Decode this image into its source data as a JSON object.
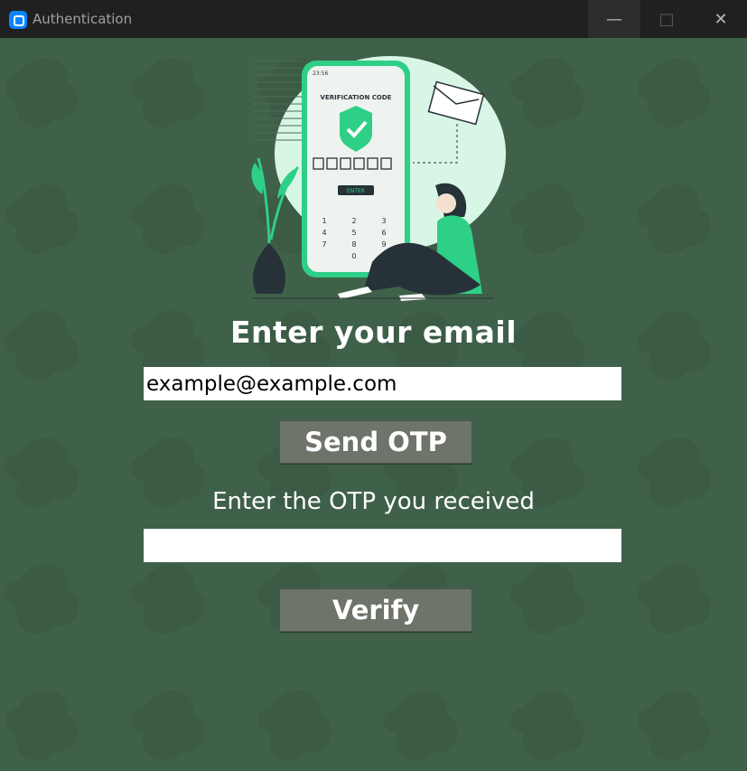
{
  "window": {
    "title": "Authentication",
    "minimize_icon": "minimize-icon",
    "maximize_icon": "maximize-icon",
    "close_icon": "close-icon"
  },
  "illustration": {
    "phone_time": "23:56",
    "screen_title": "VERIFICATION CODE",
    "enter_label": "ENTER",
    "keypad": [
      "1",
      "2",
      "3",
      "4",
      "5",
      "6",
      "7",
      "8",
      "9",
      "0"
    ]
  },
  "form": {
    "email_heading": "Enter your email",
    "email_value": "example@example.com",
    "send_button": "Send OTP",
    "otp_label": "Enter the OTP you received",
    "otp_value": "",
    "verify_button": "Verify"
  },
  "colors": {
    "background": "#3f6049",
    "accent": "#2ecf87",
    "button": "#6e7469",
    "titlebar": "#202020"
  }
}
